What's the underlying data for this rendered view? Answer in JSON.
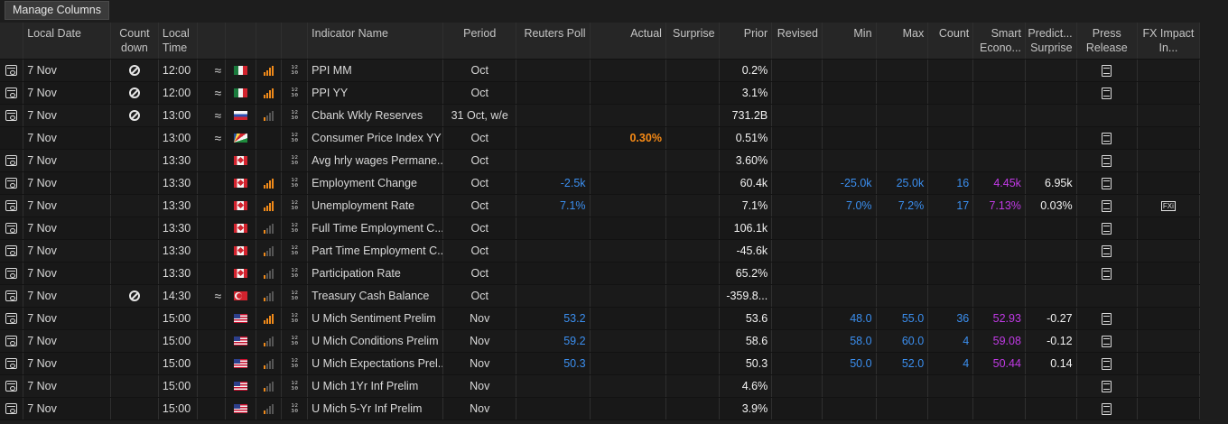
{
  "toolbar": {
    "manage_columns": "Manage Columns"
  },
  "headers": {
    "local_date": "Local Date",
    "countdown": "Count down",
    "local_time": "Local Time",
    "indicator_name": "Indicator Name",
    "period": "Period",
    "reuters_poll": "Reuters Poll",
    "actual": "Actual",
    "surprise": "Surprise",
    "prior": "Prior",
    "revised": "Revised",
    "min": "Min",
    "max": "Max",
    "count": "Count",
    "smart_econ": "Smart Econo...",
    "predict_surprise": "Predict... Surprise",
    "press_release": "Press Release",
    "fx_impact": "FX Impact In..."
  },
  "colors": {
    "poll": "#3b8ff0",
    "smart": "#c13ae6",
    "actual_highlight": "#f68a16"
  },
  "rows": [
    {
      "cal": true,
      "date": "7 Nov",
      "nosign": true,
      "time": "12:00",
      "approx": true,
      "flag": "mexico-flag",
      "bars": 4,
      "name": "PPI MM",
      "period": "Oct",
      "poll": "",
      "actual": "",
      "prior": "0.2%",
      "min": "",
      "max": "",
      "count": "",
      "smart": "",
      "predict": "",
      "press": true,
      "fx": ""
    },
    {
      "cal": true,
      "date": "7 Nov",
      "nosign": true,
      "time": "12:00",
      "approx": true,
      "flag": "mexico-flag",
      "bars": 4,
      "name": "PPI YY",
      "period": "Oct",
      "poll": "",
      "actual": "",
      "prior": "3.1%",
      "min": "",
      "max": "",
      "count": "",
      "smart": "",
      "predict": "",
      "press": true,
      "fx": ""
    },
    {
      "cal": true,
      "date": "7 Nov",
      "nosign": true,
      "time": "13:00",
      "approx": true,
      "flag": "russia-flag",
      "bars": 1,
      "name": "Cbank Wkly Reserves",
      "period": "31 Oct, w/e",
      "poll": "",
      "actual": "",
      "prior": "731.2B",
      "min": "",
      "max": "",
      "count": "",
      "smart": "",
      "predict": "",
      "press": false,
      "fx": ""
    },
    {
      "cal": false,
      "date": "7 Nov",
      "nosign": false,
      "time": "13:00",
      "approx": true,
      "flag": "seychelles-flag",
      "bars": 0,
      "name": "Consumer Price Index YY",
      "period": "Oct",
      "poll": "",
      "actual": "0.30%",
      "prior": "0.51%",
      "min": "",
      "max": "",
      "count": "",
      "smart": "",
      "predict": "",
      "press": true,
      "fx": ""
    },
    {
      "cal": true,
      "date": "7 Nov",
      "nosign": false,
      "time": "13:30",
      "approx": false,
      "flag": "canada-flag",
      "bars": 0,
      "name": "Avg hrly wages Permane...",
      "period": "Oct",
      "poll": "",
      "actual": "",
      "prior": "3.60%",
      "min": "",
      "max": "",
      "count": "",
      "smart": "",
      "predict": "",
      "press": true,
      "fx": ""
    },
    {
      "cal": true,
      "date": "7 Nov",
      "nosign": false,
      "time": "13:30",
      "approx": false,
      "flag": "canada-flag",
      "bars": 4,
      "name": "Employment Change",
      "period": "Oct",
      "poll": "-2.5k",
      "actual": "",
      "prior": "60.4k",
      "min": "-25.0k",
      "max": "25.0k",
      "count": "16",
      "smart": "4.45k",
      "predict": "6.95k",
      "press": true,
      "fx": ""
    },
    {
      "cal": true,
      "date": "7 Nov",
      "nosign": false,
      "time": "13:30",
      "approx": false,
      "flag": "canada-flag",
      "bars": 4,
      "name": "Unemployment Rate",
      "period": "Oct",
      "poll": "7.1%",
      "actual": "",
      "prior": "7.1%",
      "min": "7.0%",
      "max": "7.2%",
      "count": "17",
      "smart": "7.13%",
      "predict": "0.03%",
      "press": true,
      "fx": "FXi"
    },
    {
      "cal": true,
      "date": "7 Nov",
      "nosign": false,
      "time": "13:30",
      "approx": false,
      "flag": "canada-flag",
      "bars": 1,
      "name": "Full Time Employment C...",
      "period": "Oct",
      "poll": "",
      "actual": "",
      "prior": "106.1k",
      "min": "",
      "max": "",
      "count": "",
      "smart": "",
      "predict": "",
      "press": true,
      "fx": ""
    },
    {
      "cal": true,
      "date": "7 Nov",
      "nosign": false,
      "time": "13:30",
      "approx": false,
      "flag": "canada-flag",
      "bars": 1,
      "name": "Part Time Employment C...",
      "period": "Oct",
      "poll": "",
      "actual": "",
      "prior": "-45.6k",
      "min": "",
      "max": "",
      "count": "",
      "smart": "",
      "predict": "",
      "press": true,
      "fx": ""
    },
    {
      "cal": true,
      "date": "7 Nov",
      "nosign": false,
      "time": "13:30",
      "approx": false,
      "flag": "canada-flag",
      "bars": 1,
      "name": "Participation Rate",
      "period": "Oct",
      "poll": "",
      "actual": "",
      "prior": "65.2%",
      "min": "",
      "max": "",
      "count": "",
      "smart": "",
      "predict": "",
      "press": true,
      "fx": ""
    },
    {
      "cal": true,
      "date": "7 Nov",
      "nosign": true,
      "time": "14:30",
      "approx": true,
      "flag": "turkey-flag",
      "bars": 1,
      "name": "Treasury Cash Balance",
      "period": "Oct",
      "poll": "",
      "actual": "",
      "prior": "-359.8...",
      "min": "",
      "max": "",
      "count": "",
      "smart": "",
      "predict": "",
      "press": false,
      "fx": ""
    },
    {
      "cal": true,
      "date": "7 Nov",
      "nosign": false,
      "time": "15:00",
      "approx": false,
      "flag": "usa-flag",
      "bars": 4,
      "name": "U Mich Sentiment Prelim",
      "period": "Nov",
      "poll": "53.2",
      "actual": "",
      "prior": "53.6",
      "min": "48.0",
      "max": "55.0",
      "count": "36",
      "smart": "52.93",
      "predict": "-0.27",
      "press": true,
      "fx": ""
    },
    {
      "cal": true,
      "date": "7 Nov",
      "nosign": false,
      "time": "15:00",
      "approx": false,
      "flag": "usa-flag",
      "bars": 1,
      "name": "U Mich Conditions Prelim",
      "period": "Nov",
      "poll": "59.2",
      "actual": "",
      "prior": "58.6",
      "min": "58.0",
      "max": "60.0",
      "count": "4",
      "smart": "59.08",
      "predict": "-0.12",
      "press": true,
      "fx": ""
    },
    {
      "cal": true,
      "date": "7 Nov",
      "nosign": false,
      "time": "15:00",
      "approx": false,
      "flag": "usa-flag",
      "bars": 1,
      "name": "U Mich Expectations Prel...",
      "period": "Nov",
      "poll": "50.3",
      "actual": "",
      "prior": "50.3",
      "min": "50.0",
      "max": "52.0",
      "count": "4",
      "smart": "50.44",
      "predict": "0.14",
      "press": true,
      "fx": ""
    },
    {
      "cal": true,
      "date": "7 Nov",
      "nosign": false,
      "time": "15:00",
      "approx": false,
      "flag": "usa-flag",
      "bars": 1,
      "name": "U Mich 1Yr Inf Prelim",
      "period": "Nov",
      "poll": "",
      "actual": "",
      "prior": "4.6%",
      "min": "",
      "max": "",
      "count": "",
      "smart": "",
      "predict": "",
      "press": true,
      "fx": ""
    },
    {
      "cal": true,
      "date": "7 Nov",
      "nosign": false,
      "time": "15:00",
      "approx": false,
      "flag": "usa-flag",
      "bars": 1,
      "name": "U Mich 5-Yr Inf Prelim",
      "period": "Nov",
      "poll": "",
      "actual": "",
      "prior": "3.9%",
      "min": "",
      "max": "",
      "count": "",
      "smart": "",
      "predict": "",
      "press": true,
      "fx": ""
    }
  ]
}
